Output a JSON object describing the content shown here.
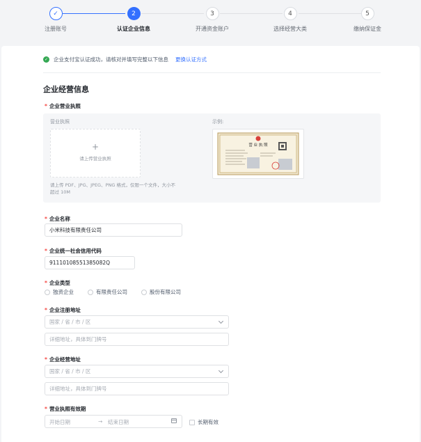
{
  "steps": [
    {
      "num": "✓",
      "label": "注册账号"
    },
    {
      "num": "2",
      "label": "认证企业信息"
    },
    {
      "num": "3",
      "label": "开通资金账户"
    },
    {
      "num": "4",
      "label": "选择经营大类"
    },
    {
      "num": "5",
      "label": "缴纳保证金"
    }
  ],
  "notice": {
    "text": "企业支付宝认证成功，请核对并填写完整以下信息",
    "link": "更换认证方式"
  },
  "section_title": "企业经营信息",
  "license": {
    "label": "企业营业执照",
    "upload_caption": "营业执照",
    "upload_plus": "+",
    "upload_text": "请上传营业执照",
    "hint": "请上传 PDF、JPG、JPEG、PNG 格式，仅限一个文件，大小不超过 10M",
    "sample_caption": "示例:",
    "sample_title": "营 业 执 照"
  },
  "company_name": {
    "label": "企业名称",
    "value": "小米科技有限责任公司"
  },
  "credit_code": {
    "label": "企业统一社会信用代码",
    "value": "91110108551385082Q"
  },
  "company_type": {
    "label": "企业类型",
    "options": [
      "独资企业",
      "有限责任公司",
      "股份有限公司"
    ]
  },
  "reg_address": {
    "label": "企业注册地址",
    "region_placeholder": "国家 / 省 / 市 / 区",
    "detail_placeholder": "详细地址，具体到门牌号"
  },
  "biz_address": {
    "label": "企业经营地址",
    "region_placeholder": "国家 / 省 / 市 / 区",
    "detail_placeholder": "详细地址，具体到门牌号"
  },
  "validity": {
    "label": "营业执照有效期",
    "start_placeholder": "开始日期",
    "separator": "→",
    "end_placeholder": "结束日期",
    "long_term": "长期有效"
  },
  "colors": {
    "primary": "#3370ff",
    "required": "#f54a45",
    "success": "#34a853"
  }
}
